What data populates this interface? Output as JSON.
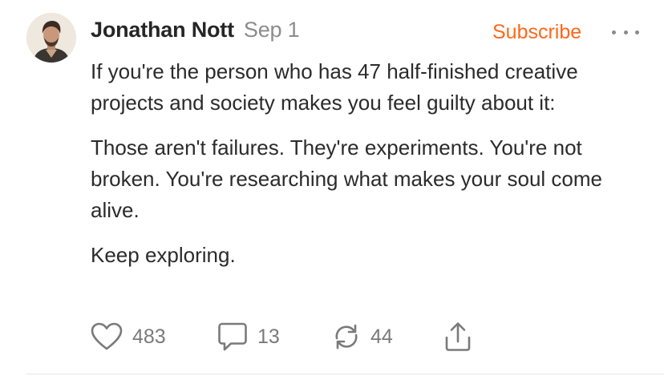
{
  "post": {
    "author": "Jonathan Nott",
    "date": "Sep 1",
    "subscribe_label": "Subscribe",
    "paragraphs": [
      "If you're the person who has 47 half-finished creative projects and society makes you feel guilty about it:",
      "Those aren't failures. They're experiments. You're not broken. You're researching what makes your soul come alive.",
      "Keep exploring."
    ]
  },
  "actions": {
    "likes": "483",
    "comments": "13",
    "restacks": "44"
  },
  "colors": {
    "accent": "#ff6719",
    "text": "#2b2b2b",
    "muted": "#8c8c8c",
    "icon": "#7a7a7a"
  },
  "icons": {
    "like": "heart-icon",
    "comment": "comment-bubble-icon",
    "restack": "restack-arrows-icon",
    "share": "share-icon",
    "more": "more-dots-icon"
  }
}
